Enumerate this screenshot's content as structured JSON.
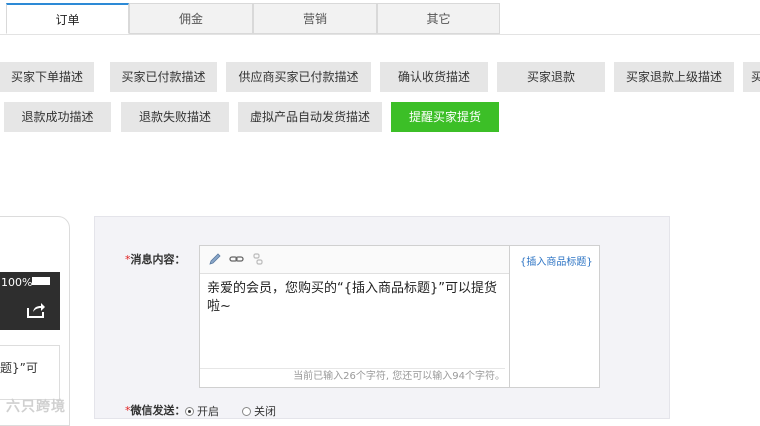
{
  "tabs": [
    {
      "label": "订单",
      "active": true
    },
    {
      "label": "佣金",
      "active": false
    },
    {
      "label": "营销",
      "active": false
    },
    {
      "label": "其它",
      "active": false
    }
  ],
  "message_buttons": {
    "row1": [
      "买家下单描述",
      "买家已付款描述",
      "供应商买家已付款描述",
      "确认收货描述",
      "买家退款",
      "买家退款上级描述",
      "买"
    ],
    "row2": [
      "退款成功描述",
      "退款失败描述",
      "虚拟产品自动发货描述",
      "提醒买家提货"
    ]
  },
  "phone_preview": {
    "battery": "100%",
    "message_snippet": "题}”可"
  },
  "form": {
    "required_mark": "*",
    "content_label": "消息内容：",
    "content_text": "亲爱的会员，您购买的“{插入商品标题}”可以提货啦~",
    "counter_text": "当前已输入26个字符, 您还可以输入94个字符。",
    "insert_link": "{插入商品标题}",
    "wechat_label": "微信发送：",
    "radio_on": "开启",
    "radio_off": "关闭",
    "wechat_enabled": true
  },
  "watermark": "六只跨境",
  "colors": {
    "accent_green": "#3cbf27",
    "tab_active": "#2d8ad6",
    "link": "#2d74c4",
    "required": "#e02020"
  }
}
